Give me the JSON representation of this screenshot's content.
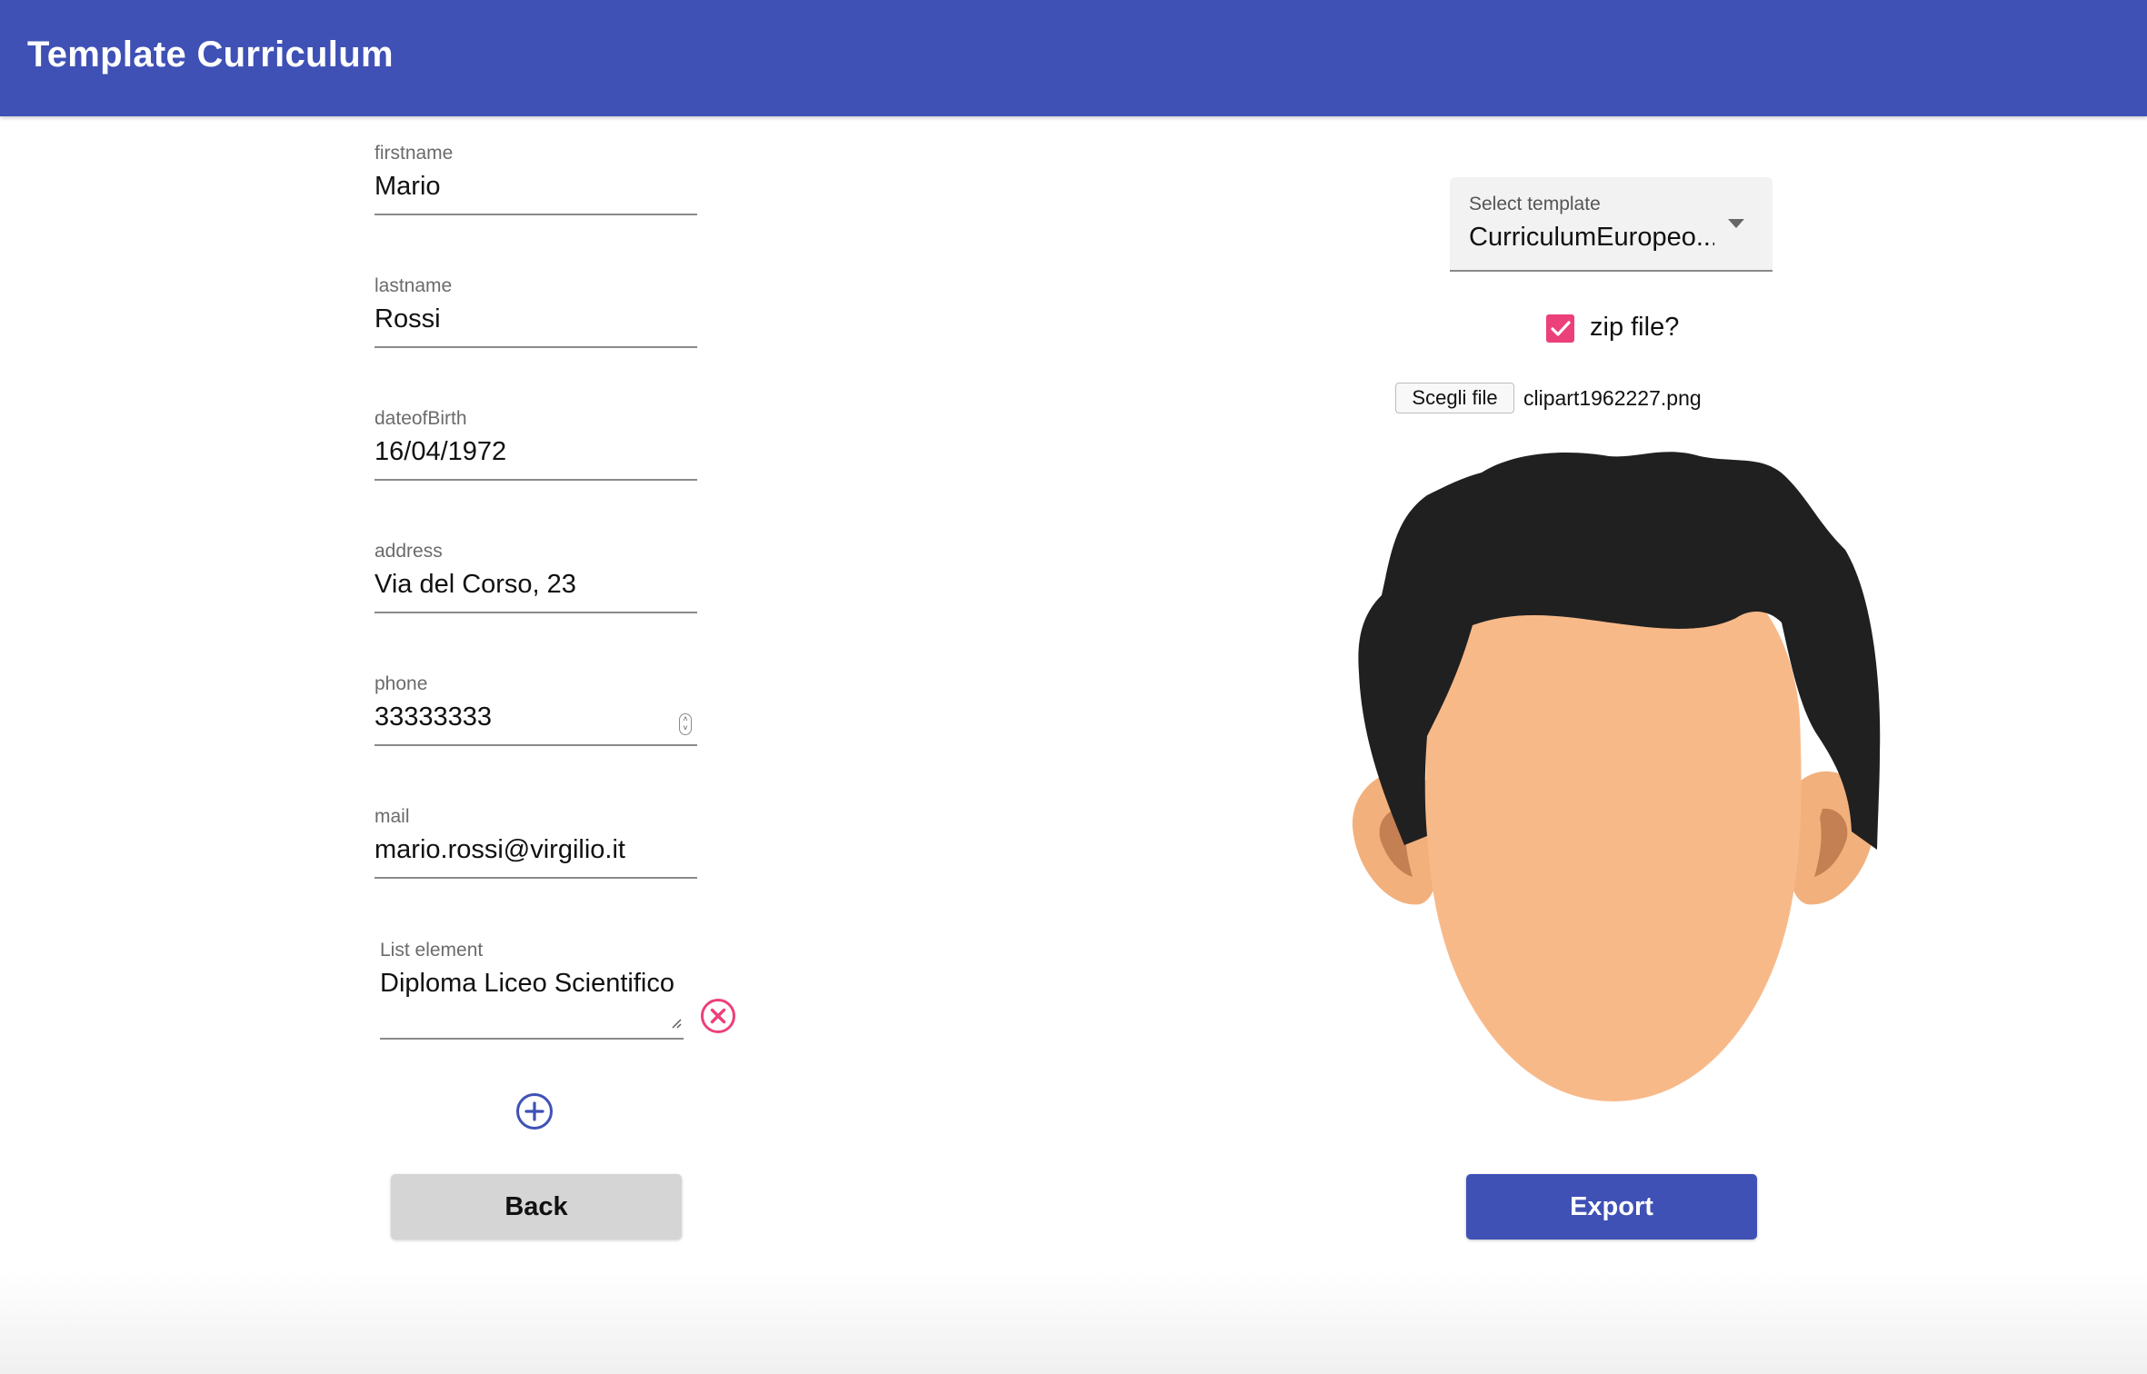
{
  "app": {
    "title": "Template Curriculum"
  },
  "form": {
    "fields": [
      {
        "label": "firstname",
        "value": "Mario"
      },
      {
        "label": "lastname",
        "value": "Rossi"
      },
      {
        "label": "dateofBirth",
        "value": "16/04/1972"
      },
      {
        "label": "address",
        "value": "Via del Corso, 23"
      },
      {
        "label": "phone",
        "value": "33333333"
      },
      {
        "label": "mail",
        "value": "mario.rossi@virgilio.it"
      }
    ],
    "list_element": {
      "label": "List element",
      "value": "Diploma Liceo Scientifico"
    },
    "back_label": "Back"
  },
  "export_panel": {
    "select": {
      "label": "Select template",
      "value": "CurriculumEuropeo...."
    },
    "zip_checkbox": {
      "label": "zip file?",
      "checked": true
    },
    "file_picker": {
      "button_label": "Scegli file",
      "file_name": "clipart1962227.png"
    },
    "export_label": "Export"
  },
  "icons": {
    "remove": "close-circle-icon",
    "add": "add-circle-icon",
    "dropdown": "dropdown-arrow-icon",
    "check": "checkmark-icon"
  },
  "colors": {
    "primary": "#3f51b5",
    "accent": "#ec407a",
    "back_button": "#d5d5d5"
  }
}
